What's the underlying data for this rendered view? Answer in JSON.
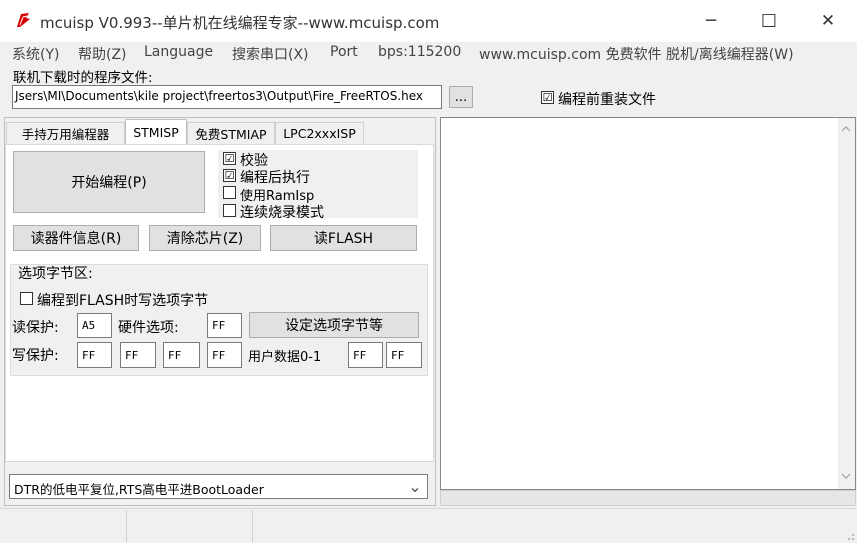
{
  "window": {
    "title": "mcuisp V0.993--单片机在线编程专家--www.mcuisp.com",
    "minimize": "─",
    "maximize": "☐",
    "close": "✕"
  },
  "menu": [
    "系统(Y)",
    "帮助(Z)",
    "Language",
    "搜索串口(X)",
    "Port",
    "bps:115200",
    "www.mcuisp.com 免费软件 脱机/离线编程器(W)"
  ],
  "file": {
    "label": "联机下载时的程序文件:",
    "path": "Jsers\\MI\\Documents\\kile project\\freertos3\\Output\\Fire_FreeRTOS.hex",
    "browse": "...",
    "reload_label": "编程前重装文件",
    "reload_checked": "☑"
  },
  "tabs": [
    "手持万用编程器",
    "STMISP",
    "免费STMIAP",
    "LPC2xxxISP"
  ],
  "stmisp": {
    "start_button": "开始编程(P)",
    "opt_verify": "校验",
    "opt_run": "编程后执行",
    "opt_ramisp": "使用RamIsp",
    "opt_continuous": "连续烧录模式",
    "check_on": "☑",
    "read_info": "读器件信息(R)",
    "erase": "清除芯片(Z)",
    "read_flash": "读FLASH",
    "option_group": "选项字节区:",
    "write_opt_label": "编程到FLASH时写选项字节",
    "read_protect_label": "读保护:",
    "read_protect_value": "A5",
    "hw_option_label": "硬件选项:",
    "hw_option_value": "FF",
    "set_option_button": "设定选项字节等",
    "write_protect_label": "写保护:",
    "write_protect_values": [
      "FF",
      "FF",
      "FF",
      "FF"
    ],
    "user_data_label": "用户数据0-1",
    "user_data_values": [
      "FF",
      "FF"
    ]
  },
  "reset_mode": {
    "selected": "DTR的低电平复位,RTS高电平进BootLoader",
    "arrow": "⌄"
  },
  "colors": {
    "icon_red": "#d40000",
    "window_bg": "#f0f0f0",
    "titlebar_bg": "#ffffff"
  }
}
